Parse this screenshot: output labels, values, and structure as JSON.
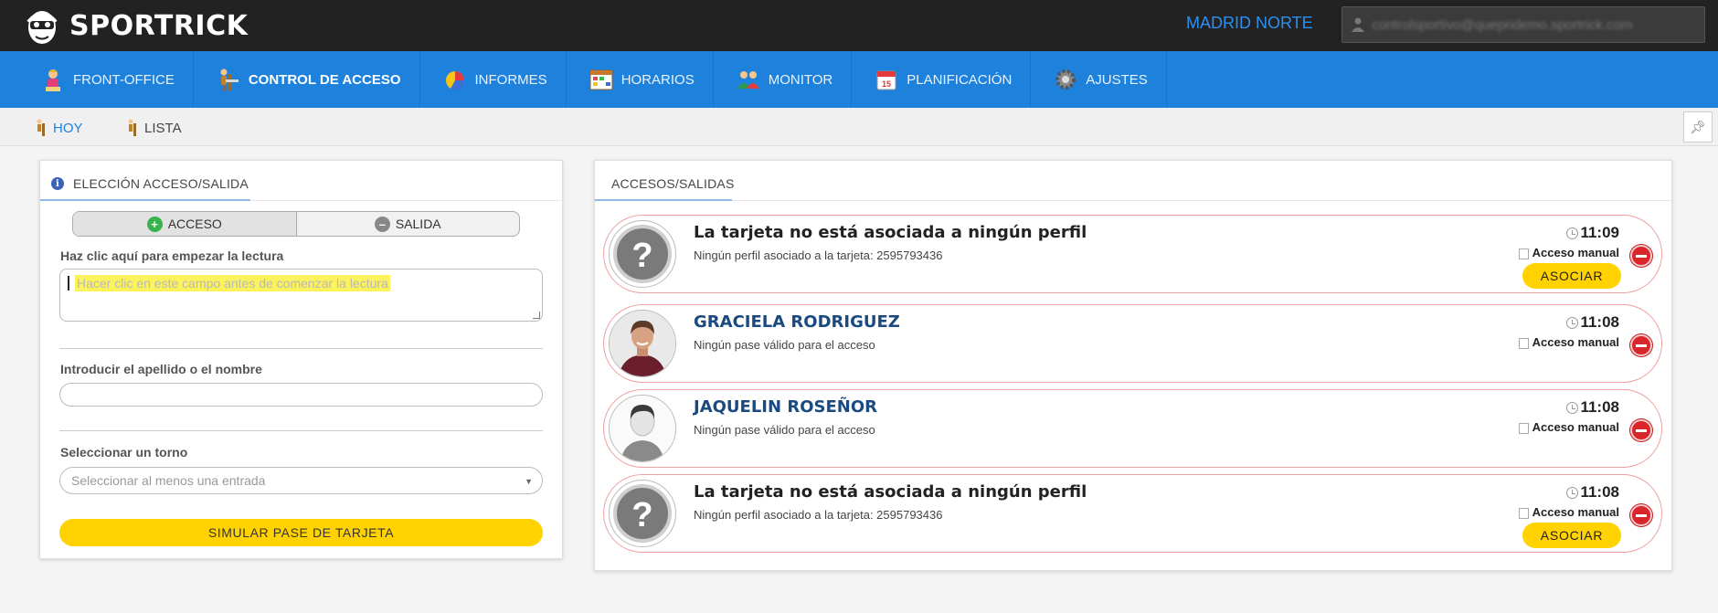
{
  "app": {
    "name": "SPORTRICK",
    "location": "MADRID NORTE",
    "user_email": "controlsportivo@quepridemo.sportrick.com"
  },
  "nav": {
    "items": [
      {
        "label": "FRONT-OFFICE",
        "icon": "receptionist-icon"
      },
      {
        "label": "CONTROL DE ACCESO",
        "icon": "turnstile-icon",
        "active": true
      },
      {
        "label": "INFORMES",
        "icon": "pie-chart-icon"
      },
      {
        "label": "HORARIOS",
        "icon": "schedule-grid-icon"
      },
      {
        "label": "MONITOR",
        "icon": "users-icon"
      },
      {
        "label": "PLANIFICACIÓN",
        "icon": "calendar-icon"
      },
      {
        "label": "AJUSTES",
        "icon": "gear-icon"
      }
    ]
  },
  "subnav": {
    "items": [
      {
        "label": "HOY",
        "active": true
      },
      {
        "label": "LISTA"
      }
    ],
    "pin_icon": "pin-icon"
  },
  "left_panel": {
    "title": "ELECCIÓN ACCESO/SALIDA",
    "toggle": {
      "acceso": "ACCESO",
      "salida": "SALIDA",
      "selected": "ACCESO"
    },
    "reader_label": "Haz clic aquí para empezar la lectura",
    "reader_placeholder": "Hacer clic en este campo antes de comenzar la lectura",
    "name_label": "Introducir el apellido o el nombre",
    "name_value": "",
    "turnstile_label": "Seleccionar un torno",
    "turnstile_placeholder": "Seleccionar al menos una entrada",
    "simulate_button": "SIMULAR PASE DE TARJETA"
  },
  "right_panel": {
    "title": "ACCESOS/SALIDAS",
    "entries": [
      {
        "title": "La tarjeta no está asociada a ningún perfil",
        "subtitle": "Ningún perfil asociado a la tarjeta: 2595793436",
        "time": "11:09",
        "mode": "Acceso manual",
        "action": "ASOCIAR",
        "avatar": "question-mark"
      },
      {
        "title": "GRACIELA RODRIGUEZ",
        "subtitle": "Ningún pase válido para el acceso",
        "time": "11:08",
        "mode": "Acceso manual",
        "avatar": "photo"
      },
      {
        "title": "JAQUELIN ROSEÑOR",
        "subtitle": "Ningún pase válido para el acceso",
        "time": "11:08",
        "mode": "Acceso manual",
        "avatar": "silhouette"
      },
      {
        "title": "La tarjeta no está asociada a ningún perfil",
        "subtitle": "Ningún perfil asociado a la tarjeta: 2595793436",
        "time": "11:08",
        "mode": "Acceso manual",
        "action": "ASOCIAR",
        "avatar": "question-mark"
      }
    ]
  },
  "colors": {
    "topbar": "#222222",
    "nav": "#1e82dd",
    "accent_yellow": "#ffd200",
    "entry_border": "#f0a0a0",
    "remove_red": "#d8262b",
    "person_name": "#1a4a80"
  }
}
